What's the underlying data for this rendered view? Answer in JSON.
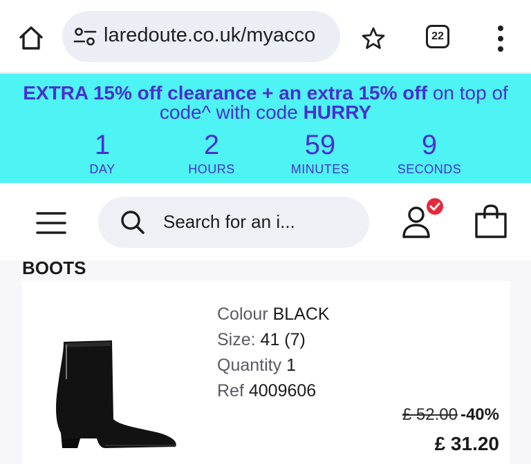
{
  "browser": {
    "url": "laredoute.co.uk/myacco",
    "tab_count": "22"
  },
  "promo": {
    "line1_bold": "EXTRA 15% off clearance + an extra 15% off",
    "line1_rest": " on top of",
    "line2_pre": "code^ with code ",
    "line2_code": "HURRY",
    "countdown": [
      {
        "value": "1",
        "label": "DAY"
      },
      {
        "value": "2",
        "label": "HOURS"
      },
      {
        "value": "59",
        "label": "MINUTES"
      },
      {
        "value": "9",
        "label": "SECONDS"
      }
    ],
    "colors": {
      "background": "#4ef3f3",
      "text": "#4a2fcf"
    }
  },
  "header": {
    "search_placeholder": "Search for an i...",
    "account_badge_color": "#e8283c"
  },
  "order": {
    "section_title": "BOOTS",
    "item": {
      "colour_label": "Colour",
      "colour_value": "BLACK",
      "size_label": "Size:",
      "size_value": "41 (7)",
      "quantity_label": "Quantity",
      "quantity_value": "1",
      "ref_label": "Ref",
      "ref_value": "4009606",
      "price_old": "£ 52.00",
      "discount": "-40%",
      "price_new": "£ 31.20"
    }
  },
  "icons": [
    "home-icon",
    "tune-icon",
    "star-icon",
    "tab-switcher-icon",
    "more-vert-icon",
    "hamburger-menu-icon",
    "search-icon",
    "account-icon",
    "check-badge-icon",
    "shopping-bag-icon"
  ]
}
